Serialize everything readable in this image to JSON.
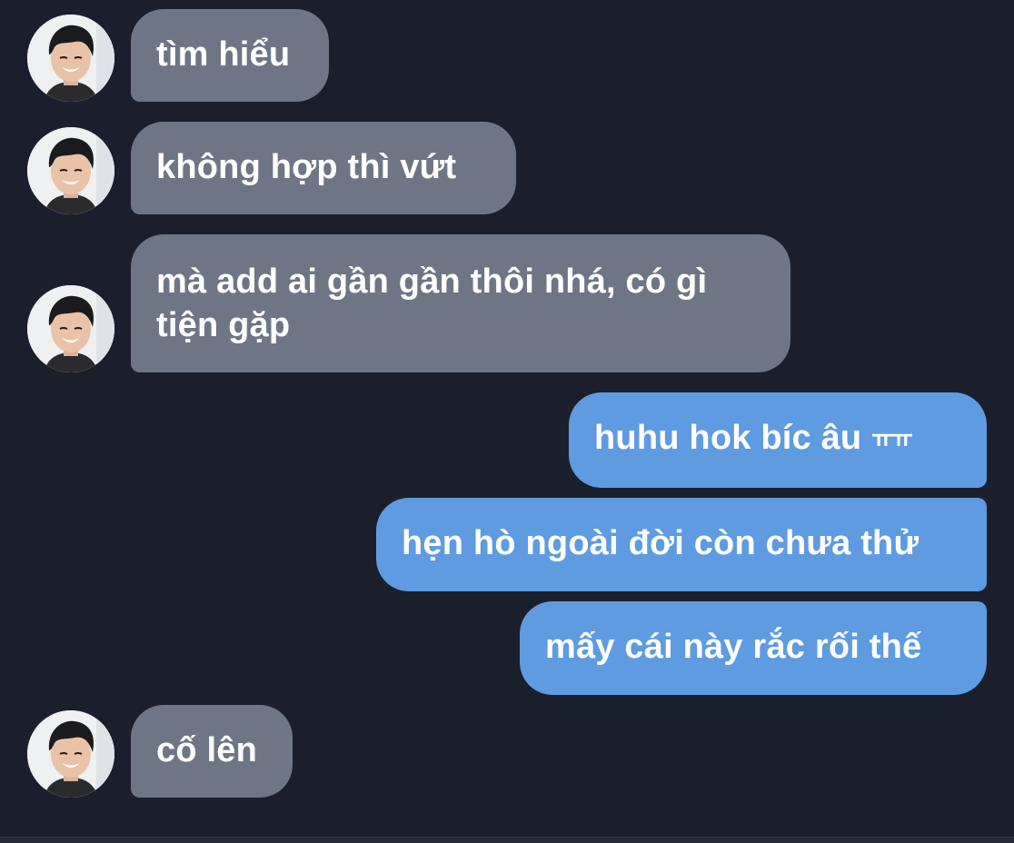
{
  "messages": [
    {
      "side": "in",
      "text": "tìm hiểu"
    },
    {
      "side": "in",
      "text": "không hợp thì vứt"
    },
    {
      "side": "in",
      "text": "mà add ai gần gần thôi nhá, có gì tiện gặp"
    },
    {
      "side": "out",
      "text": "huhu hok bíc âu ",
      "suffix": "ㅠㅠ"
    },
    {
      "side": "out",
      "text": "hẹn hò ngoài đời còn chưa thử"
    },
    {
      "side": "out",
      "text": "mấy cái này rắc rối thế"
    },
    {
      "side": "in",
      "text": "cố lên"
    }
  ],
  "colors": {
    "background": "#1b1f2c",
    "incoming_bubble": "#6e7686",
    "outgoing_bubble": "#5e9be1",
    "text": "#ffffff"
  },
  "icons": {
    "avatar": "contact-avatar-photo"
  }
}
